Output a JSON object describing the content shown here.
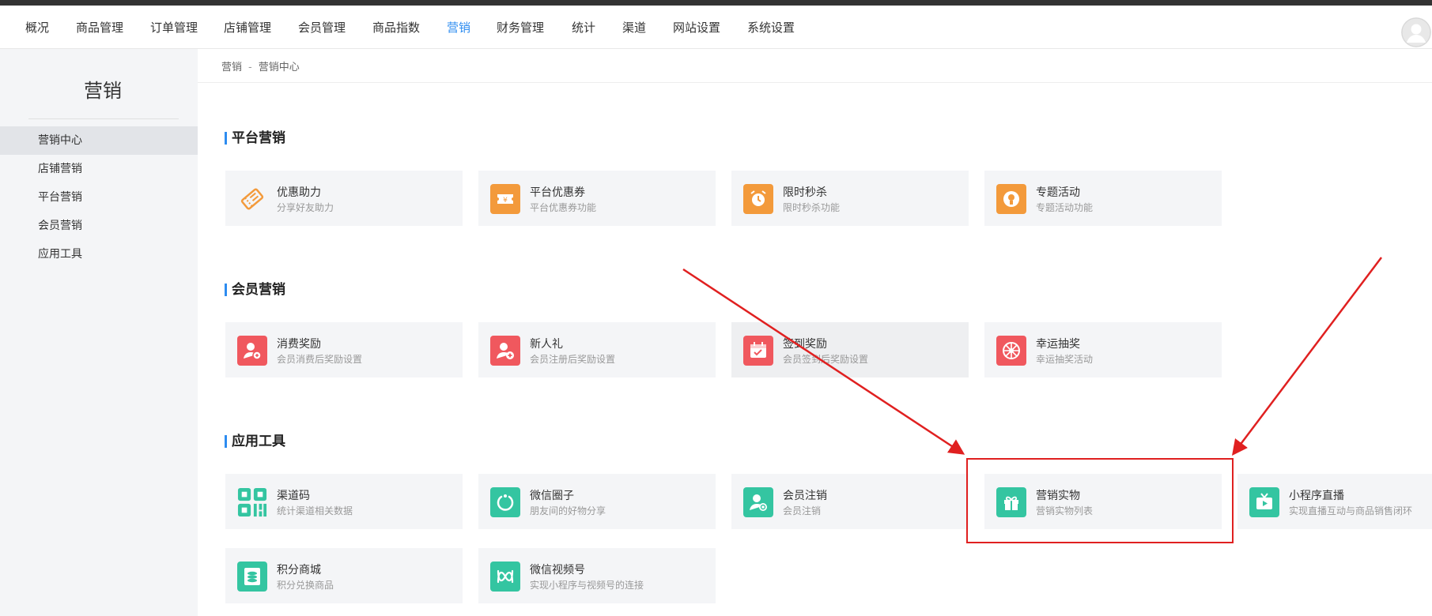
{
  "topnav": {
    "items": [
      "概况",
      "商品管理",
      "订单管理",
      "店铺管理",
      "会员管理",
      "商品指数",
      "营销",
      "财务管理",
      "统计",
      "渠道",
      "网站设置",
      "系统设置"
    ],
    "active_index": 6
  },
  "sidebar": {
    "title": "营销",
    "items": [
      "营销中心",
      "店铺营销",
      "平台营销",
      "会员营销",
      "应用工具"
    ],
    "active_index": 0
  },
  "breadcrumb": {
    "root": "营销",
    "separator": "-",
    "current": "营销中心"
  },
  "sections": [
    {
      "title": "平台营销",
      "cards": [
        {
          "title": "优惠助力",
          "subtitle": "分享好友助力",
          "icon": "ticket-icon",
          "color": "#ffffff"
        },
        {
          "title": "平台优惠券",
          "subtitle": "平台优惠券功能",
          "icon": "coupon-icon",
          "color": "#f39a3b"
        },
        {
          "title": "限时秒杀",
          "subtitle": "限时秒杀功能",
          "icon": "alarm-clock-icon",
          "color": "#f39a3b"
        },
        {
          "title": "专题活动",
          "subtitle": "专题活动功能",
          "icon": "lightbulb-icon",
          "color": "#f39a3b"
        }
      ]
    },
    {
      "title": "会员营销",
      "cards": [
        {
          "title": "消费奖励",
          "subtitle": "会员消费后奖励设置",
          "icon": "user-reward-icon",
          "color": "#f0585e"
        },
        {
          "title": "新人礼",
          "subtitle": "会员注册后奖励设置",
          "icon": "user-add-icon",
          "color": "#f0585e"
        },
        {
          "title": "签到奖励",
          "subtitle": "会员签到后奖励设置",
          "icon": "calendar-check-icon",
          "color": "#f0585e"
        },
        {
          "title": "幸运抽奖",
          "subtitle": "幸运抽奖活动",
          "icon": "wheel-icon",
          "color": "#f0585e"
        }
      ]
    },
    {
      "title": "应用工具",
      "cards": [
        {
          "title": "渠道码",
          "subtitle": "统计渠道相关数据",
          "icon": "qr-code-icon",
          "color": "#34c5a1"
        },
        {
          "title": "微信圈子",
          "subtitle": "朋友间的好物分享",
          "icon": "circle-refresh-icon",
          "color": "#34c5a1"
        },
        {
          "title": "会员注销",
          "subtitle": "会员注销",
          "icon": "user-cancel-icon",
          "color": "#34c5a1"
        },
        {
          "title": "营销实物",
          "subtitle": "营销实物列表",
          "icon": "gift-icon",
          "color": "#34c5a1"
        },
        {
          "title": "小程序直播",
          "subtitle": "实现直播互动与商品销售闭环",
          "icon": "tv-play-icon",
          "color": "#34c5a1"
        },
        {
          "title": "积分商城",
          "subtitle": "积分兑换商品",
          "icon": "coins-icon",
          "color": "#34c5a1"
        },
        {
          "title": "微信视频号",
          "subtitle": "实现小程序与视频号的连接",
          "icon": "video-channel-icon",
          "color": "#34c5a1"
        }
      ]
    }
  ],
  "colors": {
    "accent": "#2d8cf0",
    "annotation": "#e02020"
  }
}
